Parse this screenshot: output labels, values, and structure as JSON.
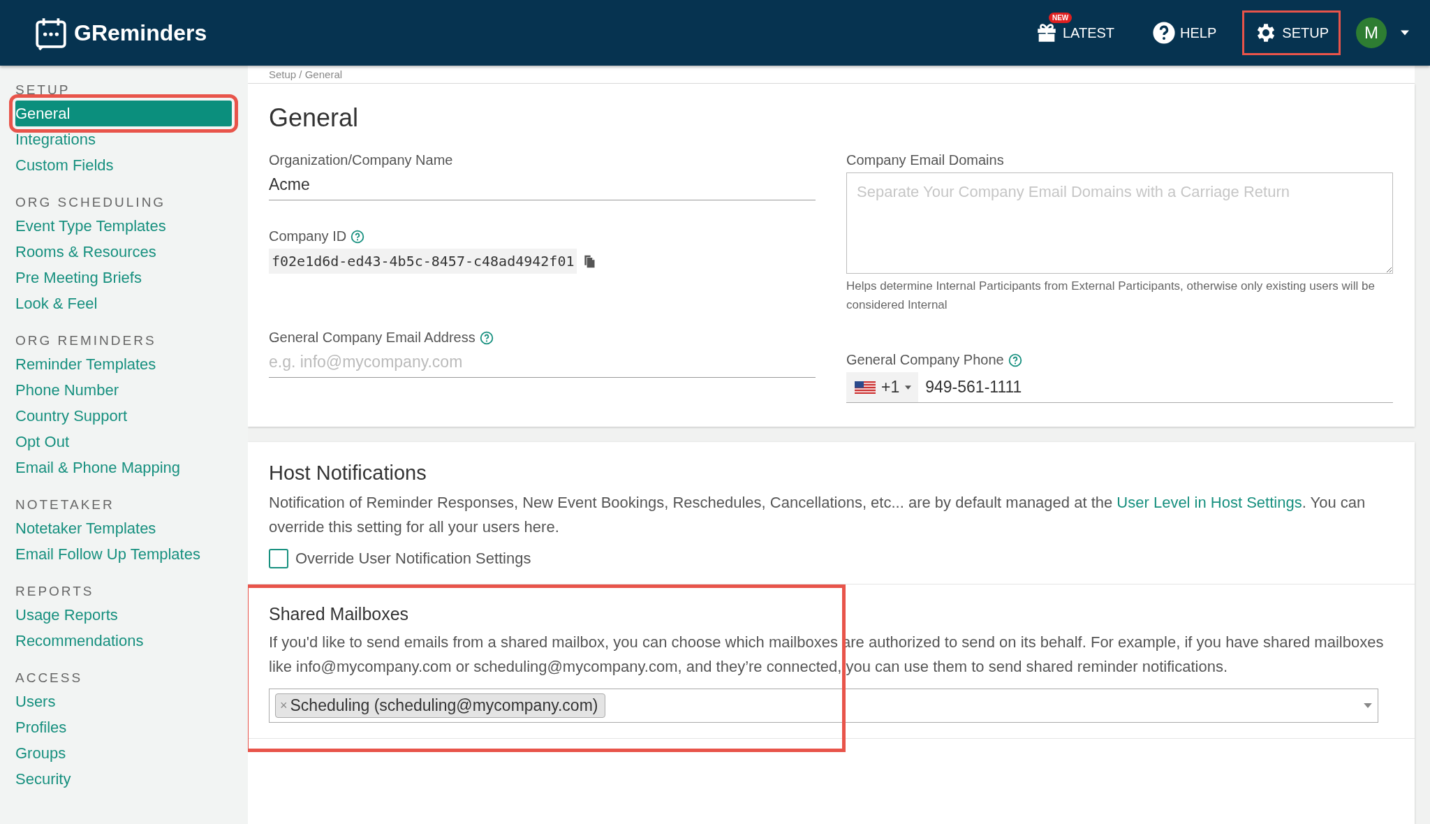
{
  "header": {
    "logo": "GReminders",
    "nav": [
      {
        "kind": "latest",
        "label": "LATEST",
        "badge": "NEW",
        "highlighted": false
      },
      {
        "kind": "help",
        "label": "HELP",
        "highlighted": false
      },
      {
        "kind": "setup",
        "label": "SETUP",
        "highlighted": true
      }
    ],
    "avatar": "M"
  },
  "sidebar": {
    "sections": [
      {
        "heading": "SETUP",
        "items": [
          {
            "label": "General",
            "selected": true,
            "highlighted": true
          },
          {
            "label": "Integrations",
            "selected": false,
            "highlighted": false
          },
          {
            "label": "Custom Fields",
            "selected": false,
            "highlighted": false
          }
        ]
      },
      {
        "heading": "ORG SCHEDULING",
        "items": [
          {
            "label": "Event Type Templates",
            "selected": false,
            "highlighted": false
          },
          {
            "label": "Rooms & Resources",
            "selected": false,
            "highlighted": false
          },
          {
            "label": "Pre Meeting Briefs",
            "selected": false,
            "highlighted": false
          },
          {
            "label": "Look & Feel",
            "selected": false,
            "highlighted": false
          }
        ]
      },
      {
        "heading": "ORG REMINDERS",
        "items": [
          {
            "label": "Reminder Templates",
            "selected": false,
            "highlighted": false
          },
          {
            "label": "Phone Number",
            "selected": false,
            "highlighted": false
          },
          {
            "label": "Country Support",
            "selected": false,
            "highlighted": false
          },
          {
            "label": "Opt Out",
            "selected": false,
            "highlighted": false
          },
          {
            "label": "Email & Phone Mapping",
            "selected": false,
            "highlighted": false
          }
        ]
      },
      {
        "heading": "NOTETAKER",
        "items": [
          {
            "label": "Notetaker Templates",
            "selected": false,
            "highlighted": false
          },
          {
            "label": "Email Follow Up Templates",
            "selected": false,
            "highlighted": false
          }
        ]
      },
      {
        "heading": "REPORTS",
        "items": [
          {
            "label": "Usage Reports",
            "selected": false,
            "highlighted": false
          },
          {
            "label": "Recommendations",
            "selected": false,
            "highlighted": false
          }
        ]
      },
      {
        "heading": "ACCESS",
        "items": [
          {
            "label": "Users",
            "selected": false,
            "highlighted": false
          },
          {
            "label": "Profiles",
            "selected": false,
            "highlighted": false
          },
          {
            "label": "Groups",
            "selected": false,
            "highlighted": false
          },
          {
            "label": "Security",
            "selected": false,
            "highlighted": false
          }
        ]
      }
    ]
  },
  "breadcrumb": "Setup / General",
  "general": {
    "title": "General",
    "company_name": {
      "label": "Organization/Company Name",
      "value": "Acme"
    },
    "company_id": {
      "label": "Company ID",
      "value": "f02e1d6d-ed43-4b5c-8457-c48ad4942f01"
    },
    "email": {
      "label": "General Company Email Address",
      "placeholder": "e.g. info@mycompany.com"
    },
    "domains": {
      "label": "Company Email Domains",
      "placeholder": "Separate Your Company Email Domains with a Carriage Return",
      "hint": "Helps determine Internal Participants from External Participants, otherwise only existing users will be considered Internal"
    },
    "phone": {
      "label": "General Company Phone",
      "country_code": "+1",
      "value": "949-561-1111"
    }
  },
  "host_notifications": {
    "title": "Host Notifications",
    "text": "Notification of Reminder Responses, New Event Bookings, Reschedules, Cancellations, etc... are by default managed at the",
    "link": "User Level in Host Settings",
    "text_after": ". You can override this setting for all your users here.",
    "checkbox": {
      "label": "Override User Notification Settings",
      "checked": false
    }
  },
  "shared_mailboxes": {
    "title": "Shared Mailboxes",
    "highlighted": true,
    "text": "If you'd like to send emails from a shared mailbox, you can choose which mailboxes are authorized to send on its behalf. For example, if you have shared mailboxes like info@mycompany.com or scheduling@mycompany.com, and they’re connected, you can use them to send shared reminder notifications.",
    "chips": [
      {
        "remove": "×",
        "label": "Scheduling (scheduling@mycompany.com)"
      }
    ]
  }
}
